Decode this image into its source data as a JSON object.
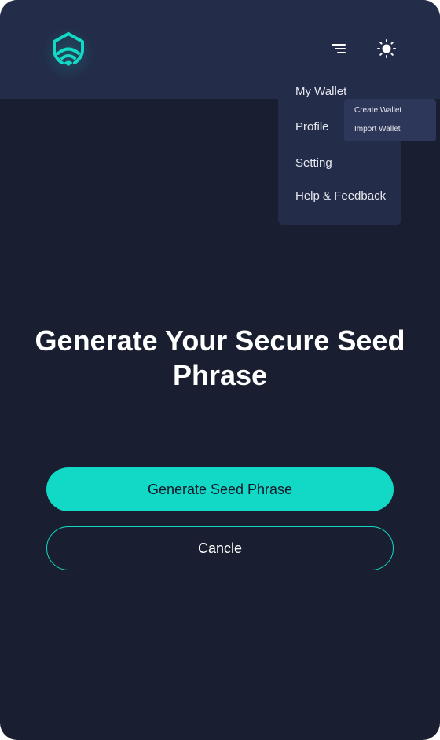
{
  "header": {
    "logo_icon": "shield-wifi-icon",
    "menu_icon": "menu-lines-icon",
    "theme_icon": "sun-icon"
  },
  "dropdown": {
    "items": [
      {
        "label": "My Wallet"
      },
      {
        "label": "Profile"
      },
      {
        "label": "Setting"
      },
      {
        "label": "Help & Feedback"
      }
    ],
    "submenu": {
      "items": [
        {
          "label": "Create Wallet"
        },
        {
          "label": "Import Wallet"
        }
      ]
    }
  },
  "main": {
    "title": "Generate Your Secure Seed Phrase",
    "primary_button": "Generate Seed Phrase",
    "secondary_button": "Cancle"
  },
  "colors": {
    "accent": "#12d9c5",
    "background": "#191f30",
    "header_background": "#232c49"
  }
}
